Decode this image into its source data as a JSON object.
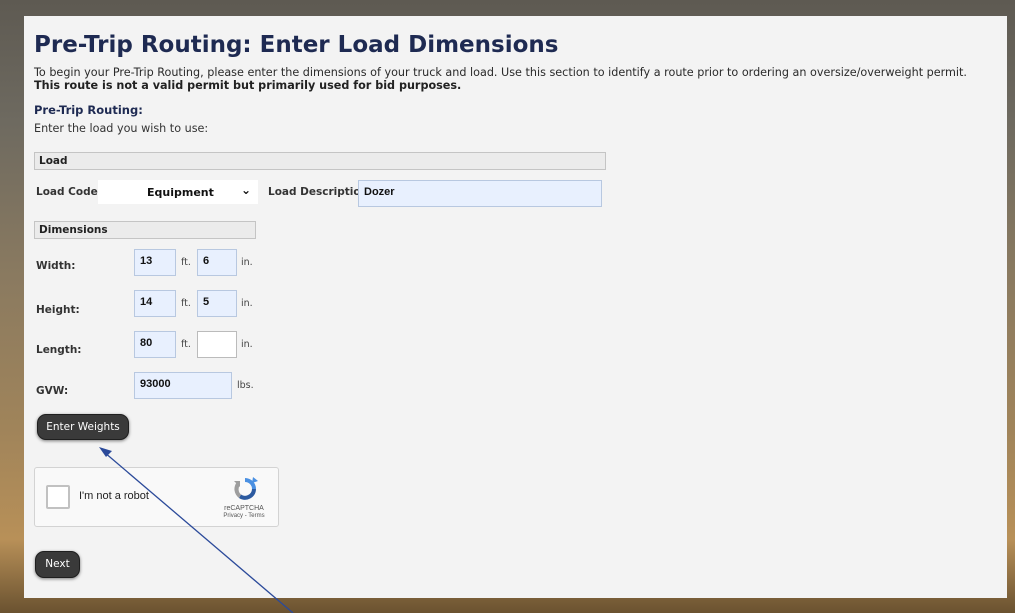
{
  "page": {
    "title": "Pre-Trip Routing: Enter Load Dimensions",
    "intro_text": "To begin your Pre-Trip Routing, please enter the dimensions of your truck and load. Use this section to identify a route prior to ordering an oversize/overweight permit.",
    "intro_bold": "This route is not a valid permit but primarily used for bid purposes.",
    "section_title": "Pre-Trip Routing:",
    "subtitle": "Enter the load you wish to use:"
  },
  "load": {
    "header": "Load",
    "code_label": "Load Code:",
    "code_value": "Equipment",
    "description_label": "Load Description:",
    "description_value": "Dozer"
  },
  "dimensions": {
    "header": "Dimensions",
    "ft_unit": "ft.",
    "in_unit": "in.",
    "width_label": "Width:",
    "width_ft": "13",
    "width_in": "6",
    "height_label": "Height:",
    "height_ft": "14",
    "height_in": "5",
    "length_label": "Length:",
    "length_ft": "80",
    "length_in": "",
    "gvw_label": "GVW:",
    "gvw_value": "93000",
    "gvw_unit": "lbs."
  },
  "buttons": {
    "enter_weights": "Enter Weights",
    "next": "Next"
  },
  "captcha": {
    "label": "I'm not a robot",
    "brand": "reCAPTCHA",
    "links": "Privacy - Terms"
  },
  "colors": {
    "title": "#1e2a52",
    "field_bg": "#e8f0fe",
    "button_bg": "#3a3a3a",
    "annotation_arrow": "#2b4a9a"
  }
}
